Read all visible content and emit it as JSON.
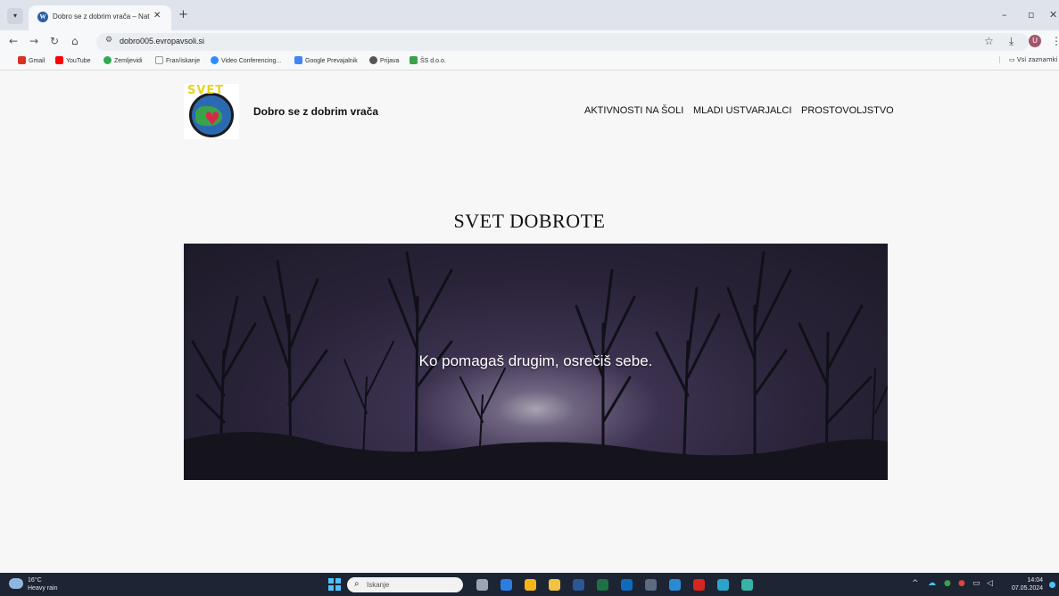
{
  "browser": {
    "tab_title": "Dobro se z dobrim vrača – Nat",
    "tab_close": "✕",
    "new_tab": "+",
    "url": "dobro005.evropavsoli.si",
    "bookmarks": [
      {
        "label": "Gmail",
        "color": "#d93025"
      },
      {
        "label": "YouTube",
        "color": "#ff0000"
      },
      {
        "label": "Zemljevidi",
        "color": "#34a853"
      },
      {
        "label": "Fran/iskanje",
        "color": "#ffffff"
      },
      {
        "label": "Video Conferencing...",
        "color": "#2d8cff"
      },
      {
        "label": "Google Prevajalnik",
        "color": "#4285f4"
      },
      {
        "label": "Prijava",
        "color": "#555555"
      },
      {
        "label": "ŠS d.o.o.",
        "color": "#3aa34a"
      }
    ],
    "all_bookmarks": "Vsi zaznamki",
    "profile_initial": "U"
  },
  "site": {
    "title": "Dobro se z dobrim vrača",
    "logo_word": "SVET",
    "nav": [
      "AKTIVNOSTI NA ŠOLI",
      "MLADI USTVARJALCI",
      "PROSTOVOLJSTVO"
    ],
    "heading": "SVET DOBROTE",
    "hero_quote": "Ko pomagaš drugim, osrečiš sebe."
  },
  "taskbar": {
    "temperature": "16°C",
    "weather": "Heavy rain",
    "search_placeholder": "Iskanje",
    "time": "14:04",
    "date": "07.05.2024",
    "apps": [
      {
        "name": "task-view-icon",
        "color": "#9aa4b4"
      },
      {
        "name": "widgets-icon",
        "color": "#2c7de0"
      },
      {
        "name": "chrome-icon",
        "color": "#f3b51a"
      },
      {
        "name": "file-explorer-icon",
        "color": "#f2c243"
      },
      {
        "name": "word-icon",
        "color": "#2b5797"
      },
      {
        "name": "excel-icon",
        "color": "#1e7145"
      },
      {
        "name": "outlook-icon",
        "color": "#0f6cbd"
      },
      {
        "name": "calculator-icon",
        "color": "#5c6b7f"
      },
      {
        "name": "help-icon",
        "color": "#2a8ad6"
      },
      {
        "name": "acrobat-icon",
        "color": "#d7261e"
      },
      {
        "name": "download-icon",
        "color": "#2aa5c9"
      },
      {
        "name": "edge-icon",
        "color": "#35b3a6"
      }
    ]
  }
}
